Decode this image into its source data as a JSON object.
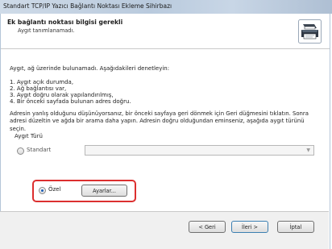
{
  "window": {
    "title": "Standart TCP/IP Yazıcı Bağlantı Noktası Ekleme Sihirbazı"
  },
  "header": {
    "title": "Ek bağlantı noktası bilgisi gerekli",
    "subtitle": "Aygıt tanımlanamadı."
  },
  "body": {
    "intro": "Aygıt, ağ üzerinde bulunamadı.  Aşağıdakileri denetleyin:",
    "checklist": [
      "1.  Aygıt açık durumda,",
      "2.  Ağ bağlantısı var,",
      "3.  Aygıt doğru olarak yapılandırılmış,",
      "4.  Bir önceki sayfada bulunan adres doğru."
    ],
    "paragraph": "Adresin yanlış olduğunu düşünüyorsanız, bir önceki sayfaya geri dönmek için Geri düğmesini tıklatın. Sonra adresi düzeltin ve ağda bir arama daha yapın. Adresin doğru olduğundan eminseniz, aşağıda aygıt türünü seçin."
  },
  "device_type": {
    "group_label": "Aygıt Türü",
    "standard_label": "Standart",
    "standard_selected": false,
    "standard_value": "",
    "custom_label": "Özel",
    "custom_selected": true,
    "settings_button": "Ayarlar..."
  },
  "footer": {
    "back": "< Geri",
    "next": "İleri >",
    "cancel": "İptal"
  },
  "colors": {
    "highlight": "#dc2f2f",
    "radio_dot": "#1c5fb8"
  },
  "icons": {
    "header": "printer-wizard-icon",
    "combo": "chevron-down-icon"
  }
}
